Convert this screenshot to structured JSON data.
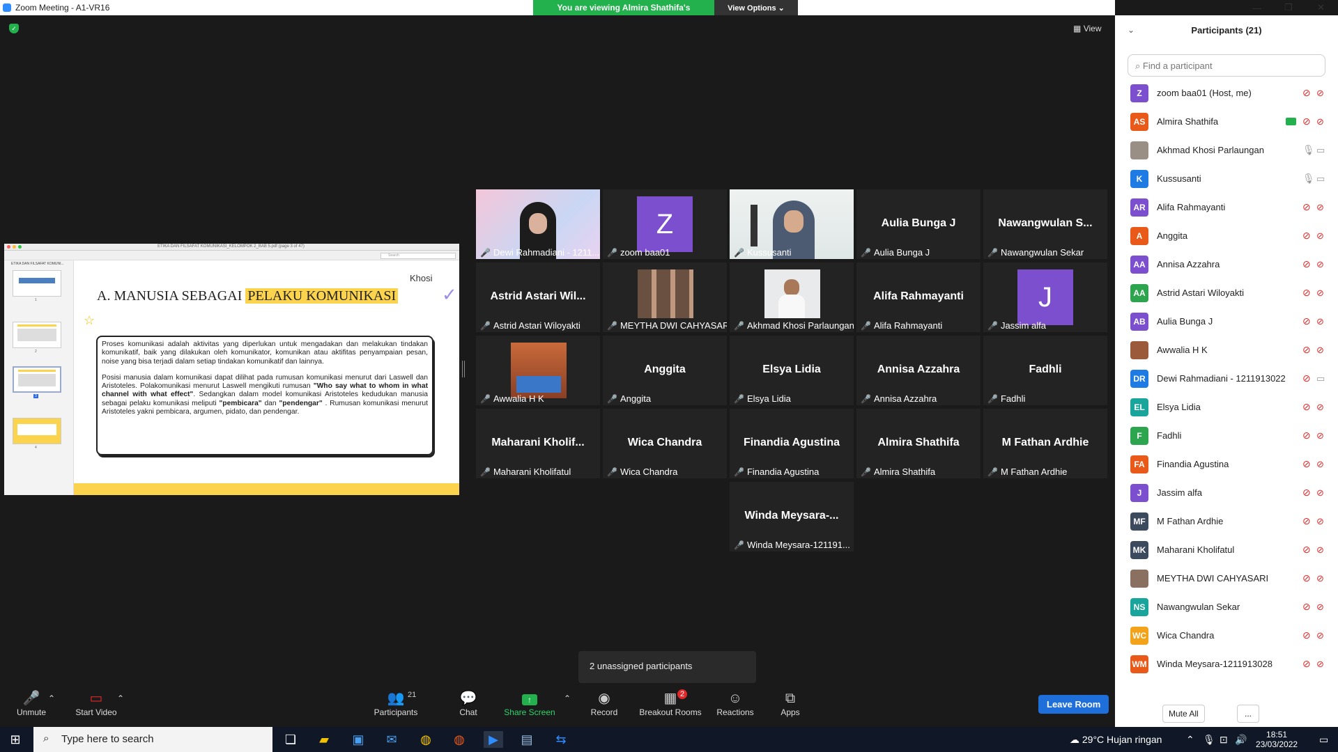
{
  "window": {
    "title": "Zoom Meeting - A1-VR16"
  },
  "banner": {
    "viewing": "You are viewing Almira Shathifa's screen",
    "view_options": "View Options"
  },
  "top": {
    "view_label": "View"
  },
  "shared_doc": {
    "title": "ETIKA DAN FILSAFAT KOMUNIKASI_KELOMPOK 2_BAB 5.pdf (page 3 of 47)",
    "search_placeholder": "Search",
    "sidebar_title": "ETIKA DAN FILSAFAT KOMUNI...",
    "thumbs": [
      "1",
      "2",
      "3",
      "4"
    ],
    "slide_author": "Khosi",
    "slide_title_a": "A. MANUSIA SEBAGAI ",
    "slide_title_b": "PELAKU KOMUNIKASI",
    "para1": "Proses komunikasi adalah aktivitas yang diperlukan untuk mengadakan dan melakukan tindakan komunikatif, baik yang dilakukan oleh komunikator, komunikan atau aktifitas penyampaian pesan, noise yang bisa terjadi dalam setiap tindakan komunikatif dan lainnya.",
    "para2_a": "Posisi manusia dalam komunikasi dapat dilihat pada rumusan komunikasi menurut dari Laswell dan Aristoteles. Polakomunikasi menurut Laswell mengikuti rumusan ",
    "para2_b": "\"Who say what to whom in what channel with what effect\"",
    "para2_c": ". Sedangkan dalam model komunikasi Aristoteles kedudukan manusia sebagai pelaku komunikasi meliputi ",
    "para2_d": "\"pembicara\"",
    "para2_e": " dan ",
    "para2_f": "\"pendengar\"",
    "para2_g": " . Rumusan komunikasi menurut Aristoteles yakni pembicara, argumen, pidato, dan pendengar."
  },
  "tiles": [
    {
      "label": "Dewi Rahmadiani - 1211...",
      "type": "photo",
      "photo": "girl-hijab"
    },
    {
      "label": "zoom baa01",
      "type": "avatar",
      "letter": "Z",
      "color": "#7b4fce"
    },
    {
      "label": "Kussusanti",
      "type": "photo",
      "photo": "woman-hijab"
    },
    {
      "label": "Aulia Bunga J",
      "type": "name",
      "big": "Aulia Bunga J"
    },
    {
      "label": "Nawangwulan Sekar",
      "type": "name",
      "big": "Nawangwulan  S..."
    },
    {
      "label": "Astrid Astari Wiloyakti",
      "type": "name",
      "big": "Astrid Astari Wil..."
    },
    {
      "label": "MEYTHA DWI CAHYASARI",
      "type": "photo",
      "photo": "collage"
    },
    {
      "label": "Akhmad Khosi Parlaungan",
      "type": "photo",
      "photo": "man",
      "active": true
    },
    {
      "label": "Alifa Rahmayanti",
      "type": "name",
      "big": "Alifa Rahmayanti"
    },
    {
      "label": "Jassim alfa",
      "type": "avatar",
      "letter": "J",
      "color": "#7b4fce"
    },
    {
      "label": "Awwalia H K",
      "type": "photo",
      "photo": "laptop"
    },
    {
      "label": "Anggita",
      "type": "name",
      "big": "Anggita"
    },
    {
      "label": "Elsya Lidia",
      "type": "name",
      "big": "Elsya Lidia"
    },
    {
      "label": "Annisa Azzahra",
      "type": "name",
      "big": "Annisa Azzahra"
    },
    {
      "label": "Fadhli",
      "type": "name",
      "big": "Fadhli"
    },
    {
      "label": "Maharani Kholifatul",
      "type": "name",
      "big": "Maharani  Kholif..."
    },
    {
      "label": "Wica Chandra",
      "type": "name",
      "big": "Wica Chandra"
    },
    {
      "label": "Finandia Agustina",
      "type": "name",
      "big": "Finandia Agustina"
    },
    {
      "label": "Almira Shathifa",
      "type": "name",
      "big": "Almira Shathifa"
    },
    {
      "label": "M Fathan Ardhie",
      "type": "name",
      "big": "M Fathan Ardhie"
    },
    {
      "label": "Winda Meysara-121191...",
      "type": "name",
      "big": "Winda  Meysara-..."
    }
  ],
  "popup": {
    "text": "2 unassigned participants"
  },
  "toolbar": {
    "unmute": "Unmute",
    "start_video": "Start Video",
    "participants": "Participants",
    "participants_count": "21",
    "chat": "Chat",
    "share": "Share Screen",
    "record": "Record",
    "breakout": "Breakout Rooms",
    "breakout_badge": "2",
    "reactions": "Reactions",
    "apps": "Apps",
    "leave": "Leave Room"
  },
  "panel": {
    "title": "Participants (21)",
    "search_placeholder": "Find a participant",
    "mute_all": "Mute All",
    "more": "...",
    "participants": [
      {
        "initials": "Z",
        "name": "zoom baa01 (Host, me)",
        "color": "#7b4fce",
        "mic": "muted",
        "cam": "off"
      },
      {
        "initials": "AS",
        "name": "Almira Shathifa",
        "color": "#e8591a",
        "mic": "muted",
        "cam": "off",
        "sharing": true
      },
      {
        "initials": "",
        "name": "Akhmad Khosi Parlaungan",
        "color": "#9a8f85",
        "mic": "on",
        "cam": "on",
        "photo": true
      },
      {
        "initials": "K",
        "name": "Kussusanti",
        "color": "#1e7be3",
        "mic": "on",
        "cam": "on"
      },
      {
        "initials": "AR",
        "name": "Alifa Rahmayanti",
        "color": "#7b4fce",
        "mic": "muted",
        "cam": "off"
      },
      {
        "initials": "A",
        "name": "Anggita",
        "color": "#e8591a",
        "mic": "muted",
        "cam": "off"
      },
      {
        "initials": "AA",
        "name": "Annisa Azzahra",
        "color": "#7b4fce",
        "mic": "muted",
        "cam": "off"
      },
      {
        "initials": "AA",
        "name": "Astrid Astari Wiloyakti",
        "color": "#2da44e",
        "mic": "muted",
        "cam": "off"
      },
      {
        "initials": "AB",
        "name": "Aulia Bunga J",
        "color": "#7b4fce",
        "mic": "muted",
        "cam": "off"
      },
      {
        "initials": "",
        "name": "Awwalia H K",
        "color": "#9b5a3a",
        "mic": "muted",
        "cam": "off",
        "photo": true
      },
      {
        "initials": "DR",
        "name": "Dewi Rahmadiani - 1211913022",
        "color": "#1e7be3",
        "mic": "muted",
        "cam": "on"
      },
      {
        "initials": "EL",
        "name": "Elsya Lidia",
        "color": "#1aa59c",
        "mic": "muted",
        "cam": "off"
      },
      {
        "initials": "F",
        "name": "Fadhli",
        "color": "#2da44e",
        "mic": "muted",
        "cam": "off"
      },
      {
        "initials": "FA",
        "name": "Finandia Agustina",
        "color": "#e8591a",
        "mic": "muted",
        "cam": "off"
      },
      {
        "initials": "J",
        "name": "Jassim alfa",
        "color": "#7b4fce",
        "mic": "muted",
        "cam": "off"
      },
      {
        "initials": "MF",
        "name": "M Fathan Ardhie",
        "color": "#3c4a5e",
        "mic": "muted",
        "cam": "off"
      },
      {
        "initials": "MK",
        "name": "Maharani Kholifatul",
        "color": "#3c4a5e",
        "mic": "muted",
        "cam": "off"
      },
      {
        "initials": "",
        "name": "MEYTHA DWI CAHYASARI",
        "color": "#8a7060",
        "mic": "muted",
        "cam": "off",
        "photo": true
      },
      {
        "initials": "NS",
        "name": "Nawangwulan Sekar",
        "color": "#1aa59c",
        "mic": "muted",
        "cam": "off"
      },
      {
        "initials": "WC",
        "name": "Wica Chandra",
        "color": "#f2a31a",
        "mic": "muted",
        "cam": "off"
      },
      {
        "initials": "WM",
        "name": "Winda Meysara-1211913028",
        "color": "#e8591a",
        "mic": "muted",
        "cam": "off"
      }
    ]
  },
  "taskbar": {
    "search_placeholder": "Type here to search",
    "weather": "29°C  Hujan ringan",
    "time": "18:51",
    "date": "23/03/2022"
  }
}
